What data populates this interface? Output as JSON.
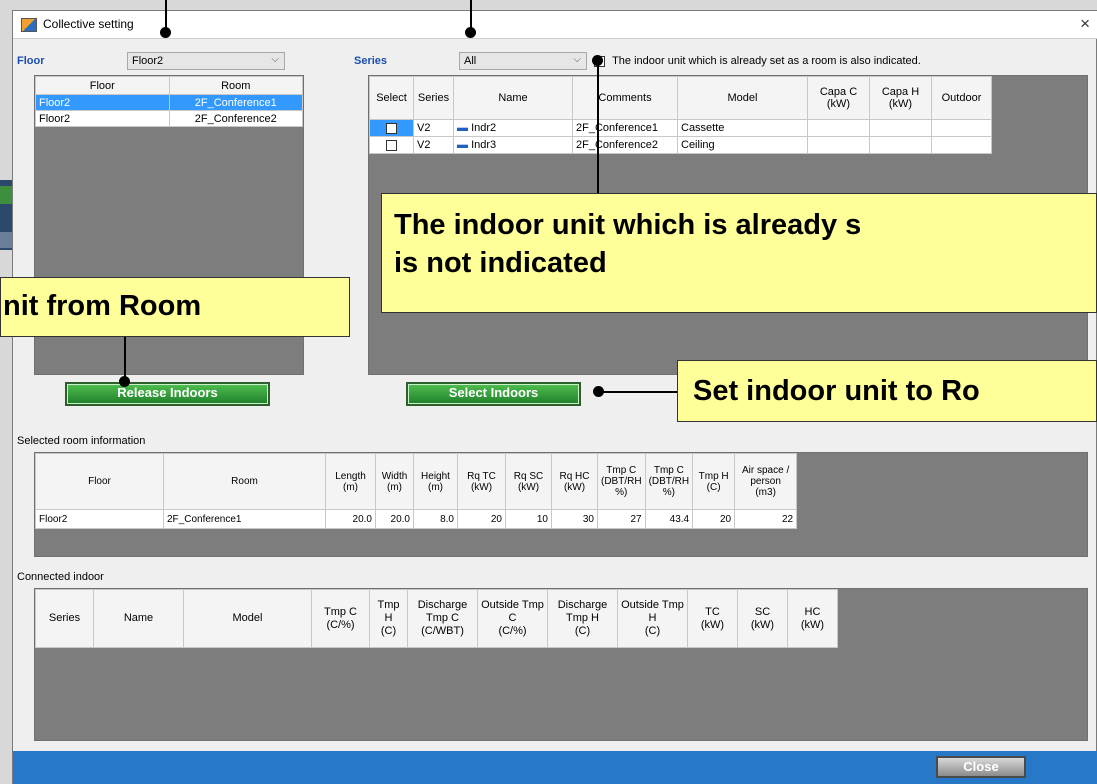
{
  "window": {
    "title": "Collective setting",
    "close_symbol": "×"
  },
  "floor_section": {
    "label": "Floor",
    "combo_value": "Floor2",
    "headers": [
      "Floor",
      "Room"
    ],
    "rows": [
      {
        "floor": "Floor2",
        "room": "2F_Conference1",
        "selected": true
      },
      {
        "floor": "Floor2",
        "room": "2F_Conference2",
        "selected": false
      }
    ]
  },
  "series_section": {
    "label": "Series",
    "combo_value": "All",
    "checkbox_label": "The indoor unit which is already set as a room is also indicated.",
    "headers": [
      "Select",
      "Series",
      "Name",
      "Comments",
      "Model",
      "Capa C\n(kW)",
      "Capa H\n(kW)",
      "Outdoor"
    ],
    "rows": [
      {
        "series": "V2",
        "name": "Indr2",
        "comments": "2F_Conference1",
        "model": "Cassette"
      },
      {
        "series": "V2",
        "name": "Indr3",
        "comments": "2F_Conference2",
        "model": "Ceiling"
      }
    ]
  },
  "buttons": {
    "release": "Release Indoors",
    "select": "Select Indoors",
    "close": "Close"
  },
  "callouts": {
    "indoor_line1": "The indoor unit which is already s",
    "indoor_line2": "is not indicated",
    "release": "nit from Room",
    "set_indoor": "Set indoor unit to Ro"
  },
  "selected_room": {
    "label": "Selected room information",
    "headers": [
      "Floor",
      "Room",
      "Length\n(m)",
      "Width\n(m)",
      "Height\n(m)",
      "Rq TC\n(kW)",
      "Rq SC\n(kW)",
      "Rq HC\n(kW)",
      "Tmp C\n(DBT/RH\n%)",
      "Tmp C\n(DBT/RH\n%)",
      "Tmp H\n(C)",
      "Air space /\nperson\n(m3)"
    ],
    "row": [
      "Floor2",
      "2F_Conference1",
      "20.0",
      "20.0",
      "8.0",
      "20",
      "10",
      "30",
      "27",
      "43.4",
      "20",
      "22"
    ]
  },
  "connected_indoor": {
    "label": "Connected indoor",
    "headers": [
      "Series",
      "Name",
      "Model",
      "Tmp C\n(C/%)",
      "Tmp H\n(C)",
      "Discharge\nTmp C\n(C/WBT)",
      "Outside Tmp\nC\n(C/%)",
      "Discharge\nTmp H\n(C)",
      "Outside Tmp\nH\n(C)",
      "TC\n(kW)",
      "SC\n(kW)",
      "HC\n(kW)"
    ]
  }
}
